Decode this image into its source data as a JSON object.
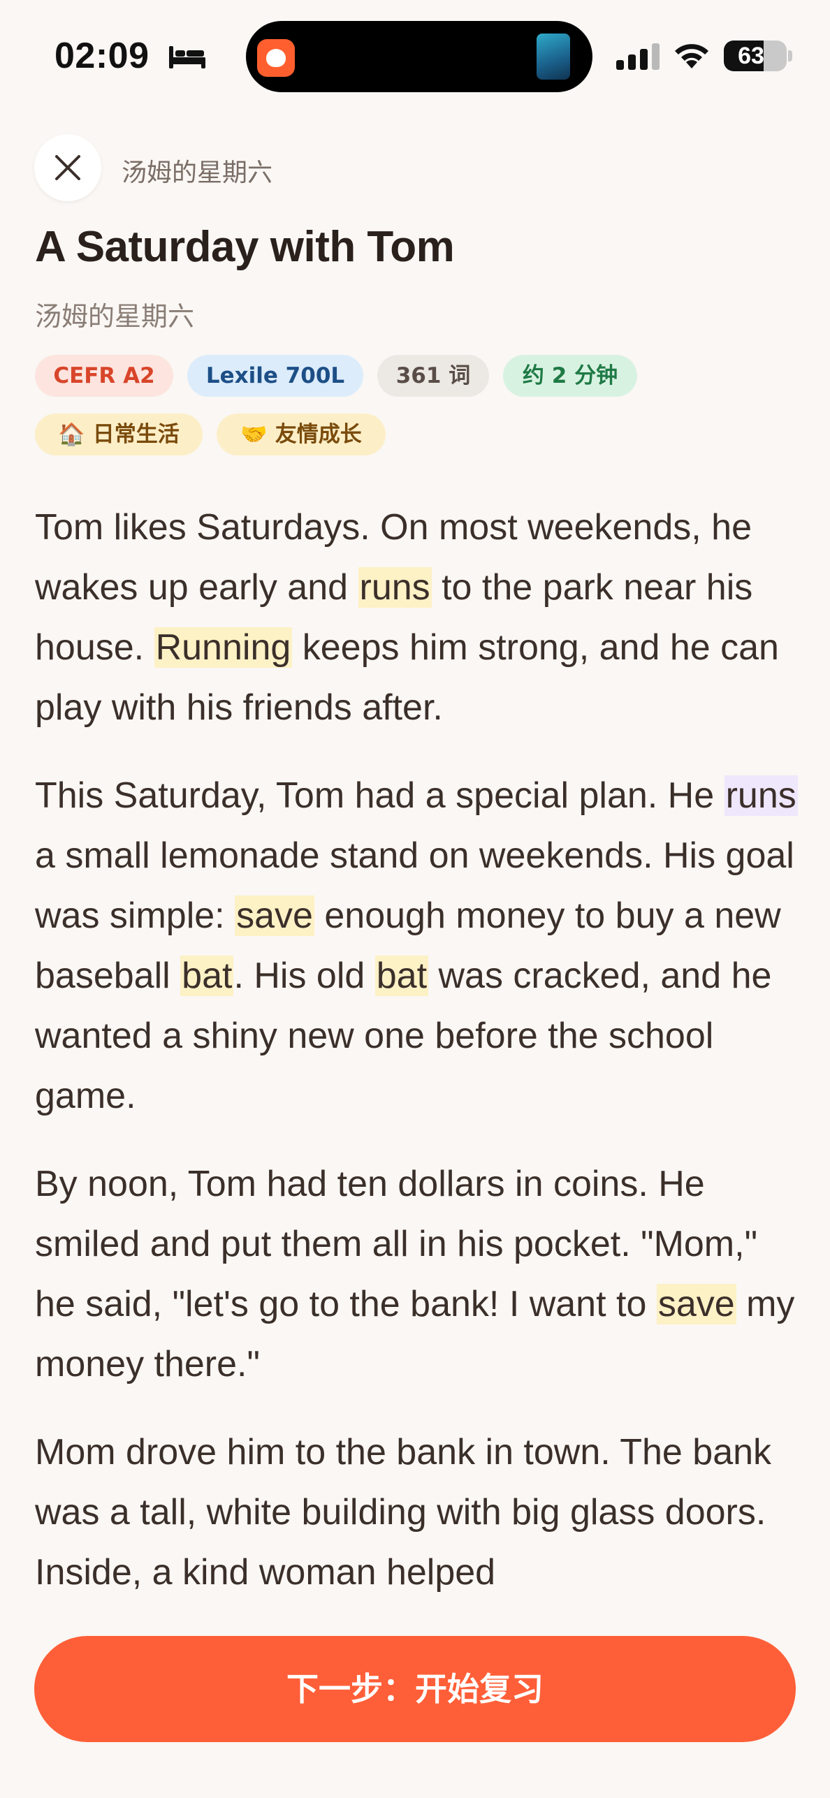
{
  "status_bar": {
    "time": "02:09",
    "battery_percent": "63",
    "battery_level": 0.63,
    "icons": [
      "bed-icon",
      "signal-icon",
      "wifi-icon",
      "battery-icon"
    ]
  },
  "header": {
    "close_icon": "close-icon",
    "title": "汤姆的星期六"
  },
  "story": {
    "title": "A Saturday with Tom",
    "subtitle": "汤姆的星期六"
  },
  "tags": {
    "cefr": "CEFR A2",
    "lexile": "Lexile 700L",
    "words": "361 词",
    "duration": "约 2 分钟",
    "life": "🏠 日常生活",
    "friendship": "🤝 友情成长"
  },
  "article": {
    "p1": [
      {
        "t": "Tom likes Saturdays. On most weekends, he wakes up early and "
      },
      {
        "t": "runs",
        "h": "y"
      },
      {
        "t": " to the park near his house. "
      },
      {
        "t": "Running",
        "h": "y"
      },
      {
        "t": " keeps him strong, and he can play with his friends after."
      }
    ],
    "p2": [
      {
        "t": "This Saturday, Tom had a special plan. He "
      },
      {
        "t": "runs",
        "h": "v"
      },
      {
        "t": " a small lemonade stand on weekends. His goal was simple: "
      },
      {
        "t": "save",
        "h": "y"
      },
      {
        "t": " enough money to buy a new baseball "
      },
      {
        "t": "bat",
        "h": "y"
      },
      {
        "t": ". His old "
      },
      {
        "t": "bat",
        "h": "y"
      },
      {
        "t": " was cracked, and he wanted a shiny new one before the school game."
      }
    ],
    "p3": [
      {
        "t": "By noon, Tom had ten dollars in coins. He smiled and put them all in his pocket. \"Mom,\" he said, \"let's go to the bank! I want to "
      },
      {
        "t": "save",
        "h": "y"
      },
      {
        "t": " my money there.\""
      }
    ],
    "p4": [
      {
        "t": "Mom drove him to the bank in town. The bank was a tall, white building with big glass doors. Inside, a kind woman helped"
      }
    ]
  },
  "footer": {
    "next_button": "下一步：开始复习"
  },
  "colors": {
    "accent": "#ff5f38",
    "highlight_yellow": "#fdf1c6",
    "highlight_violet": "#efe7fc",
    "background": "#faf7f4"
  }
}
